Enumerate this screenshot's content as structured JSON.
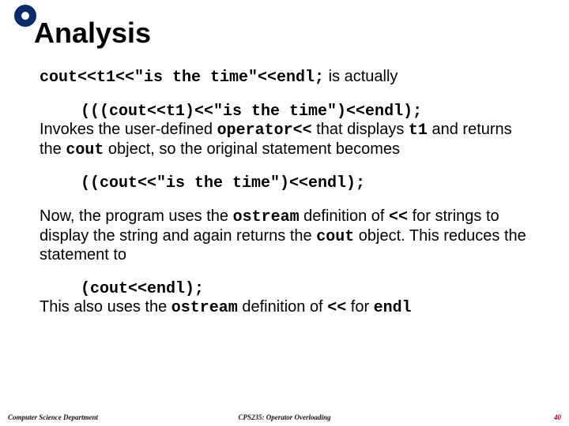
{
  "title": "Analysis",
  "lines": {
    "p1_code": "cout<<t1<<\"is the time\"<<endl;",
    "p1_tail": " is actually",
    "p2_code1": "(((cout<<t1)<<\"is the time\")<<endl);",
    "p2_run1": "Invokes the user-defined ",
    "p2_op": "operator<<",
    "p2_run2": " that displays ",
    "p2_t1": "t1",
    "p2_run3": " and returns the ",
    "p2_cout": "cout",
    "p2_run4": " object, so the original statement becomes",
    "p3_code": "((cout<<\"is the time\")<<endl);",
    "p4_run1": "Now, the program uses the ",
    "p4_ostream": "ostream",
    "p4_run2": " definition of ",
    "p4_op": "<<",
    "p4_run3": " for strings to display the string and again returns the ",
    "p4_cout": "cout",
    "p4_run4": " object. This reduces the statement to",
    "p5_code": "(cout<<endl);",
    "p5_run1": "This also uses the ",
    "p5_ostream": "ostream",
    "p5_run2": " definition of ",
    "p5_op": "<<",
    "p5_run3": " for ",
    "p5_endl": "endl"
  },
  "footer": {
    "left": "Computer Science Department",
    "center": "CPS235: Operator Overloading",
    "page": "40"
  }
}
